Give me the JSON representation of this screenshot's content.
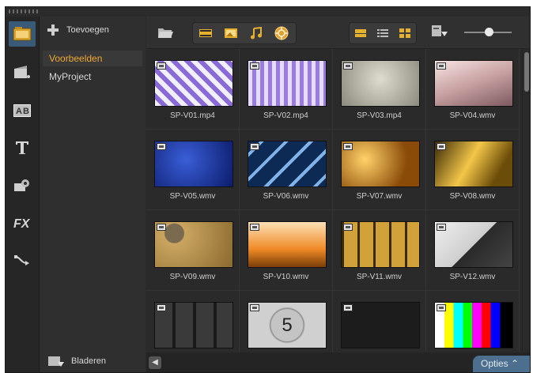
{
  "panel": {
    "add_label": "Toevoegen",
    "folders": [
      "Voorbeelden",
      "MyProject"
    ],
    "selected_folder": "Voorbeelden",
    "browse_label": "Bladeren"
  },
  "rail": [
    "media-library-icon",
    "instant-project-icon",
    "transition-icon",
    "title-icon",
    "graphic-icon",
    "filter-icon",
    "path-icon"
  ],
  "options_label": "Opties",
  "media": [
    {
      "name": "SP-V01.mp4",
      "style": "mosaic-purple"
    },
    {
      "name": "SP-V02.mp4",
      "style": "mosaic-lilac"
    },
    {
      "name": "SP-V03.mp4",
      "style": "plain-beige"
    },
    {
      "name": "SP-V04.wmv",
      "style": "soft-pink"
    },
    {
      "name": "SP-V05.wmv",
      "style": "blue"
    },
    {
      "name": "SP-V06.wmv",
      "style": "blue-streak"
    },
    {
      "name": "SP-V07.wmv",
      "style": "gold-bokeh"
    },
    {
      "name": "SP-V08.wmv",
      "style": "gold-rays"
    },
    {
      "name": "SP-V09.wmv",
      "style": "vintage-clock"
    },
    {
      "name": "SP-V10.wmv",
      "style": "orange-glow"
    },
    {
      "name": "SP-V11.wmv",
      "style": "film-strip"
    },
    {
      "name": "SP-V12.wmv",
      "style": "photo-frame"
    },
    {
      "name": "",
      "style": "dark-screens"
    },
    {
      "name": "",
      "style": "countdown"
    },
    {
      "name": "",
      "style": "black"
    },
    {
      "name": "",
      "style": "test-pattern"
    }
  ],
  "countdown_number": "5"
}
